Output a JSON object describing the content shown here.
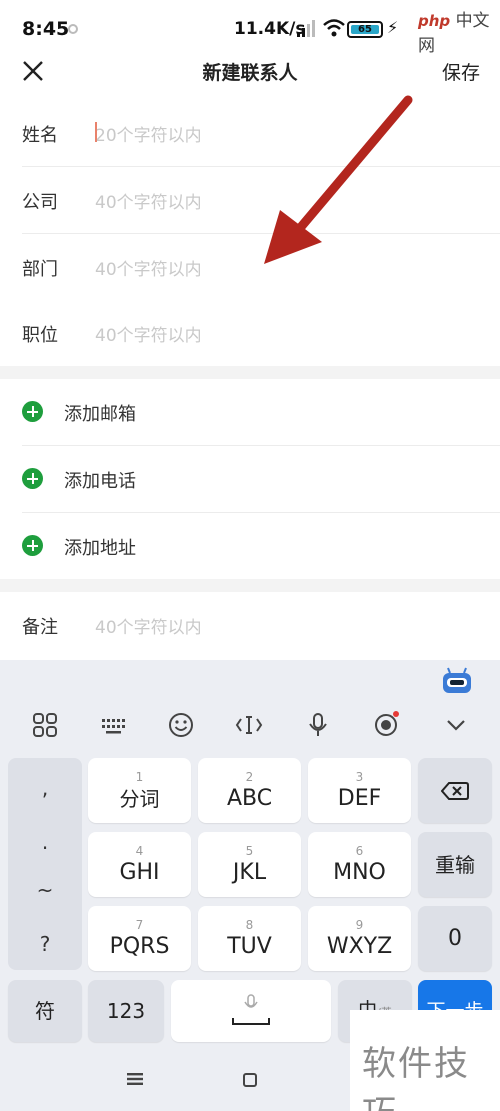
{
  "status_bar": {
    "time": "8:45",
    "network_speed": "11.4K/s",
    "battery_level": "65",
    "watermark_logo": "php 中文网",
    "watermark_php": "php",
    "watermark_cn": "中文网"
  },
  "header": {
    "title": "新建联系人",
    "save_label": "保存",
    "close_icon": "close-icon"
  },
  "form": {
    "fields": [
      {
        "label": "姓名",
        "placeholder": "20个字符以内"
      },
      {
        "label": "公司",
        "placeholder": "40个字符以内"
      },
      {
        "label": "部门",
        "placeholder": "40个字符以内"
      },
      {
        "label": "职位",
        "placeholder": "40个字符以内"
      }
    ],
    "add_actions": [
      {
        "label": "添加邮箱"
      },
      {
        "label": "添加电话"
      },
      {
        "label": "添加地址"
      }
    ],
    "note": {
      "label": "备注",
      "placeholder": "40个字符以内"
    }
  },
  "keyboard": {
    "toolbar_icons": [
      "grid-icon",
      "keyboard-layout-icon",
      "emoji-icon",
      "cursor-icon",
      "microphone-icon",
      "sticker-icon",
      "collapse-icon"
    ],
    "side_punctuation": [
      ",",
      ".",
      "~",
      "?"
    ],
    "keys": [
      {
        "digit": "1",
        "label": "分词"
      },
      {
        "digit": "2",
        "label": "ABC"
      },
      {
        "digit": "3",
        "label": "DEF"
      },
      {
        "digit": "4",
        "label": "GHI"
      },
      {
        "digit": "5",
        "label": "JKL"
      },
      {
        "digit": "6",
        "label": "MNO"
      },
      {
        "digit": "7",
        "label": "PQRS"
      },
      {
        "digit": "8",
        "label": "TUV"
      },
      {
        "digit": "9",
        "label": "WXYZ"
      }
    ],
    "backspace_icon": "backspace-icon",
    "reinput_label": "重输",
    "zero_label": "0",
    "symbol_label": "符",
    "numbers_label": "123",
    "lang_label": "中",
    "lang_alt": "/英",
    "enter_label": "下一步",
    "accent_color": "#1777e8"
  },
  "watermark": {
    "text": "软件技巧"
  },
  "colors": {
    "plus_green": "#1e9e3d",
    "arrow_red": "#b3261e"
  }
}
